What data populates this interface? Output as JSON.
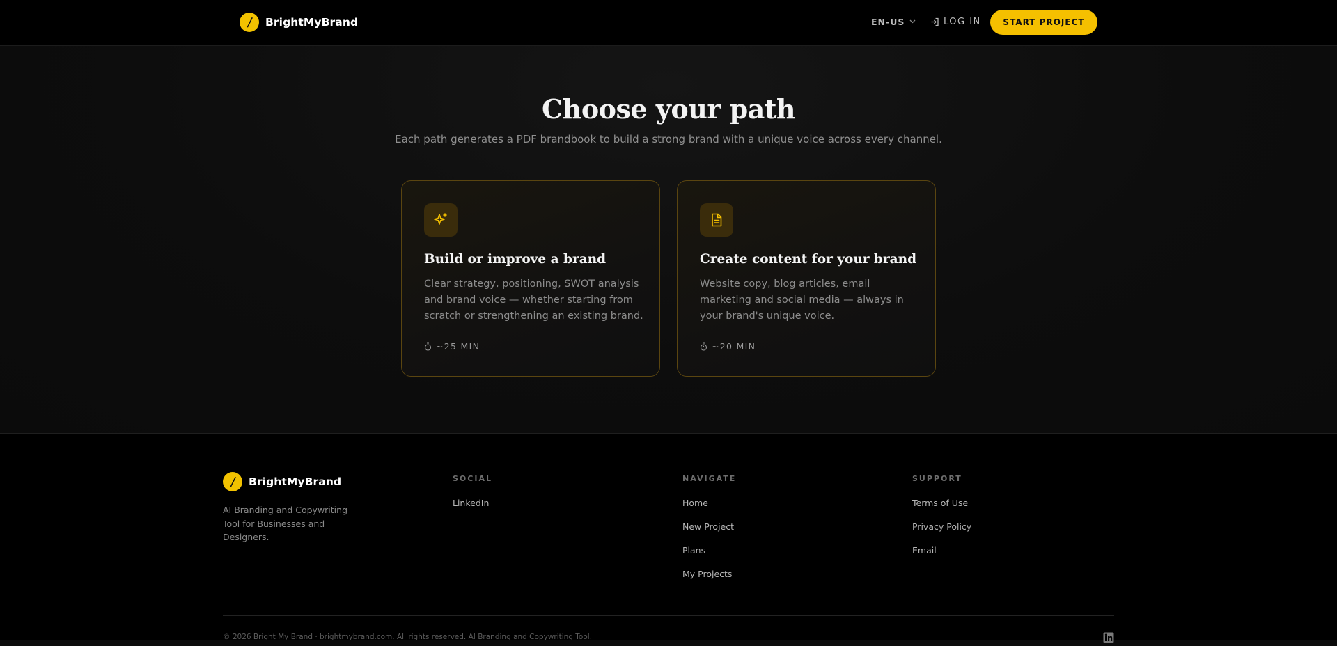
{
  "header": {
    "brand": "BrightMyBrand",
    "language": "EN-US",
    "login_label": "LOG IN",
    "start_label": "START PROJECT"
  },
  "main": {
    "title": "Choose your path",
    "subtitle": "Each path generates a PDF brandbook to build a strong brand with a unique voice across every channel.",
    "cards": [
      {
        "icon": "sparkles-icon",
        "title": "Build or improve a brand",
        "description": "Clear strategy, positioning, SWOT analysis and brand voice — whether starting from scratch or strengthening an existing brand.",
        "time": "~25 MIN"
      },
      {
        "icon": "document-icon",
        "title": "Create content for your brand",
        "description": "Website copy, blog articles, email marketing and social media — always in your brand's unique voice.",
        "time": "~20 MIN"
      }
    ]
  },
  "footer": {
    "brand": "BrightMyBrand",
    "tagline": "AI Branding and Copywriting Tool for Businesses and Designers.",
    "social": {
      "title": "SOCIAL",
      "links": [
        "LinkedIn"
      ]
    },
    "navigate": {
      "title": "NAVIGATE",
      "links": [
        "Home",
        "New Project",
        "Plans",
        "My Projects"
      ]
    },
    "support": {
      "title": "SUPPORT",
      "links": [
        "Terms of Use",
        "Privacy Policy",
        "Email"
      ]
    },
    "copyright": "© 2026 Bright My Brand · brightmybrand.com. All rights reserved. AI Branding and Copywriting Tool."
  },
  "colors": {
    "accent": "#f5c000",
    "background": "#0c0c0c",
    "card_border": "#5a4510"
  }
}
